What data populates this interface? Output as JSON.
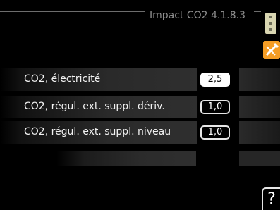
{
  "header": {
    "title": "Impact CO2 4.1.8.3"
  },
  "icons": {
    "side_top": "thermostat-icon",
    "side_bottom": "tools-icon",
    "help": "help-icon"
  },
  "settings": [
    {
      "label": "CO2, électricité",
      "value": "2,5",
      "selected": true
    },
    {
      "label": "CO2, régul. ext. suppl. dériv.",
      "value": "1,0",
      "selected": false
    },
    {
      "label": "CO2, régul. ext. suppl. niveau",
      "value": "1,0",
      "selected": false
    }
  ],
  "help": {
    "glyph": "?"
  },
  "colors": {
    "accent": "#f59d25",
    "title": "#8e8e8e"
  }
}
